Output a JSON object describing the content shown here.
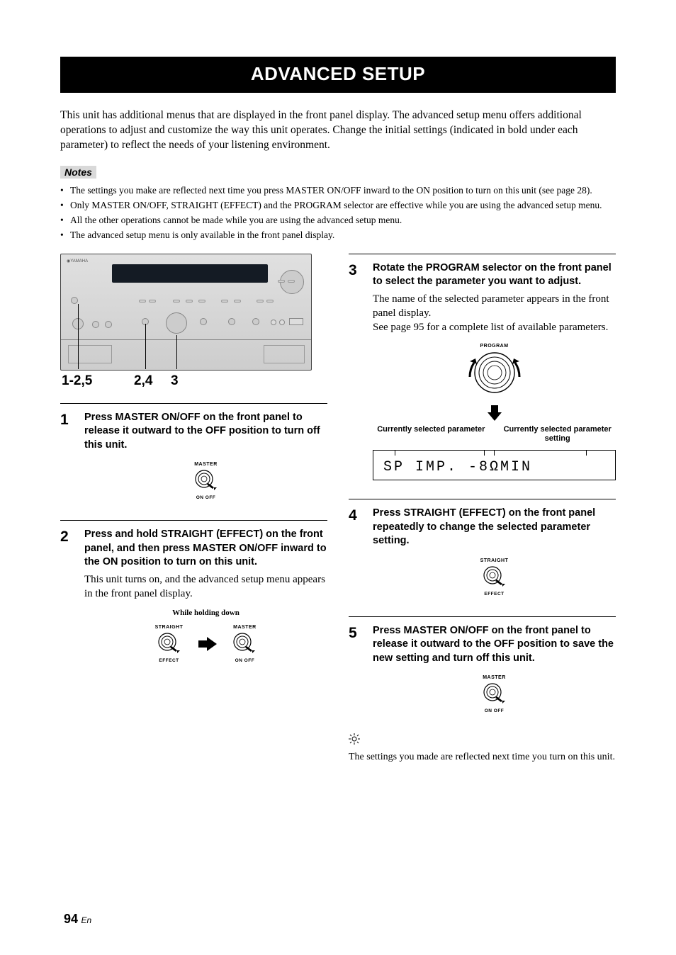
{
  "title": "ADVANCED SETUP",
  "intro": "This unit has additional menus that are displayed in the front panel display. The advanced setup menu offers additional operations to adjust and customize the way this unit operates. Change the initial settings (indicated in bold under each parameter) to reflect the needs of your listening environment.",
  "notesLabel": "Notes",
  "notes": [
    "The settings you make are reflected next time you press MASTER ON/OFF inward to the ON position to turn on this unit (see page 28).",
    "Only MASTER ON/OFF, STRAIGHT (EFFECT) and the PROGRAM selector are effective while you are using the advanced setup menu.",
    "All the other operations cannot be made while you are using the advanced setup menu.",
    "The advanced setup menu is only available in the front panel display."
  ],
  "panelRefs": {
    "a": "1-2,5",
    "b": "2,4",
    "c": "3"
  },
  "steps": {
    "s1": {
      "num": "1",
      "head": "Press MASTER ON/OFF on the front panel to release it outward to the OFF position to turn off this unit."
    },
    "s2": {
      "num": "2",
      "head": "Press and hold STRAIGHT (EFFECT) on the front panel, and then press MASTER ON/OFF inward to the ON position to turn on this unit.",
      "text": "This unit turns on, and the advanced setup menu appears in the front panel display."
    },
    "s3": {
      "num": "3",
      "head": "Rotate the PROGRAM selector on the front panel to select the parameter you want to adjust.",
      "text1": "The name of the selected parameter appears in the front panel display.",
      "text2": "See page 95 for a complete list of available parameters."
    },
    "s4": {
      "num": "4",
      "head": "Press STRAIGHT (EFFECT) on the front panel repeatedly to change the selected parameter setting."
    },
    "s5": {
      "num": "5",
      "head": "Press MASTER ON/OFF on the front panel to release it outward to the OFF position to save the new setting and turn off this unit."
    }
  },
  "labels": {
    "master": "MASTER",
    "onoff": "ON    OFF",
    "straight": "STRAIGHT",
    "effect": "EFFECT",
    "holding": "While holding down",
    "program": "PROGRAM",
    "curParam": "Currently selected parameter",
    "curSetting": "Currently selected parameter setting",
    "lcd": "SP IMP. -8ΩMIN"
  },
  "tip": "The settings you made are reflected next time you turn on this unit.",
  "pageNum": "94",
  "pageSuffix": "En"
}
